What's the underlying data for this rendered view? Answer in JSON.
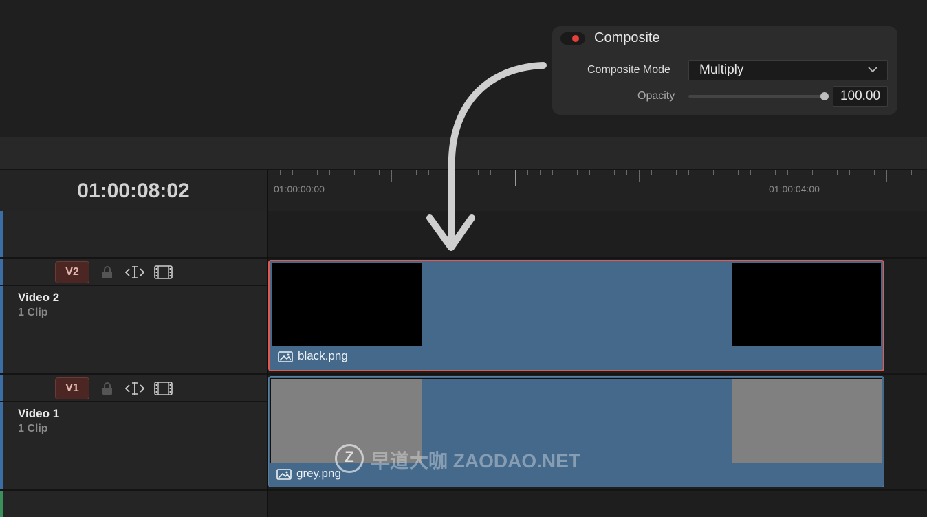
{
  "composite": {
    "title": "Composite",
    "enabled": true,
    "mode_label": "Composite Mode",
    "mode_value": "Multiply",
    "opacity_label": "Opacity",
    "opacity_value": "100.00",
    "opacity_percent": 100,
    "accent_color": "#e5413a"
  },
  "timeline": {
    "timecode": "01:00:08:02",
    "ruler_labels": [
      "01:00:00:00",
      "01:00:04:00"
    ]
  },
  "tracks": [
    {
      "badge": "V2",
      "name": "Video 2",
      "clip_count": "1 Clip",
      "clip_name": "black.png",
      "selected": true
    },
    {
      "badge": "V1",
      "name": "Video 1",
      "clip_count": "1 Clip",
      "clip_name": "grey.png",
      "selected": false
    }
  ],
  "watermark": {
    "logo": "Z",
    "text": "早道大咖  ZAODAO.NET"
  },
  "icons": [
    "lock-icon",
    "auto-select-icon",
    "film-strip-icon",
    "image-icon",
    "chevron-down-icon",
    "annotation-arrow"
  ],
  "colors": {
    "clip_blue": "#45698a",
    "selection_red": "#e05a4f",
    "badge_bg": "#4b2622"
  }
}
